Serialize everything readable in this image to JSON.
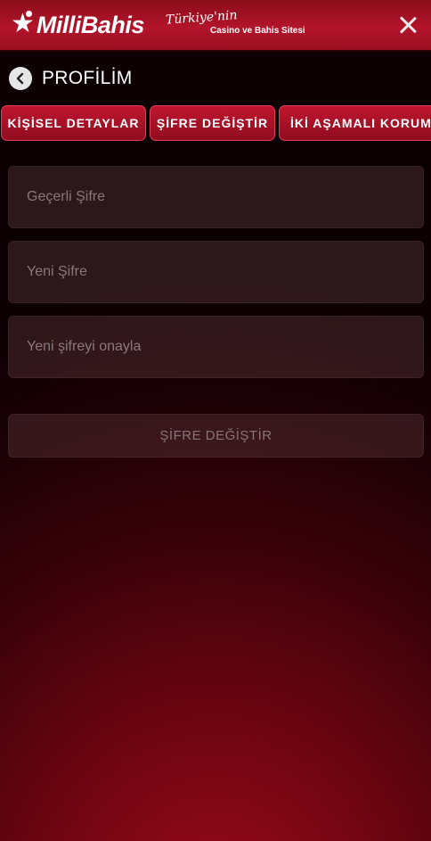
{
  "header": {
    "brand_name": "MilliBahis",
    "tagline_script": "Türkiye'nin",
    "tagline_sub": "Casino ve Bahis Sitesi"
  },
  "profile": {
    "title": "PROFİLİM"
  },
  "tabs": [
    {
      "label": "KİŞİSEL DETAYLAR"
    },
    {
      "label": "ŞİFRE DEĞİŞTİR"
    },
    {
      "label": "İKİ AŞAMALI KORUMA"
    }
  ],
  "form": {
    "current_password_placeholder": "Geçerli Şifre",
    "new_password_placeholder": "Yeni Şifre",
    "confirm_password_placeholder": "Yeni şifreyi onayla",
    "submit_label": "ŞİFRE DEĞİŞTİR"
  },
  "colors": {
    "brand_red": "#b3142a",
    "background_dark": "#0c0003",
    "background_glow": "#9a0a1a"
  }
}
